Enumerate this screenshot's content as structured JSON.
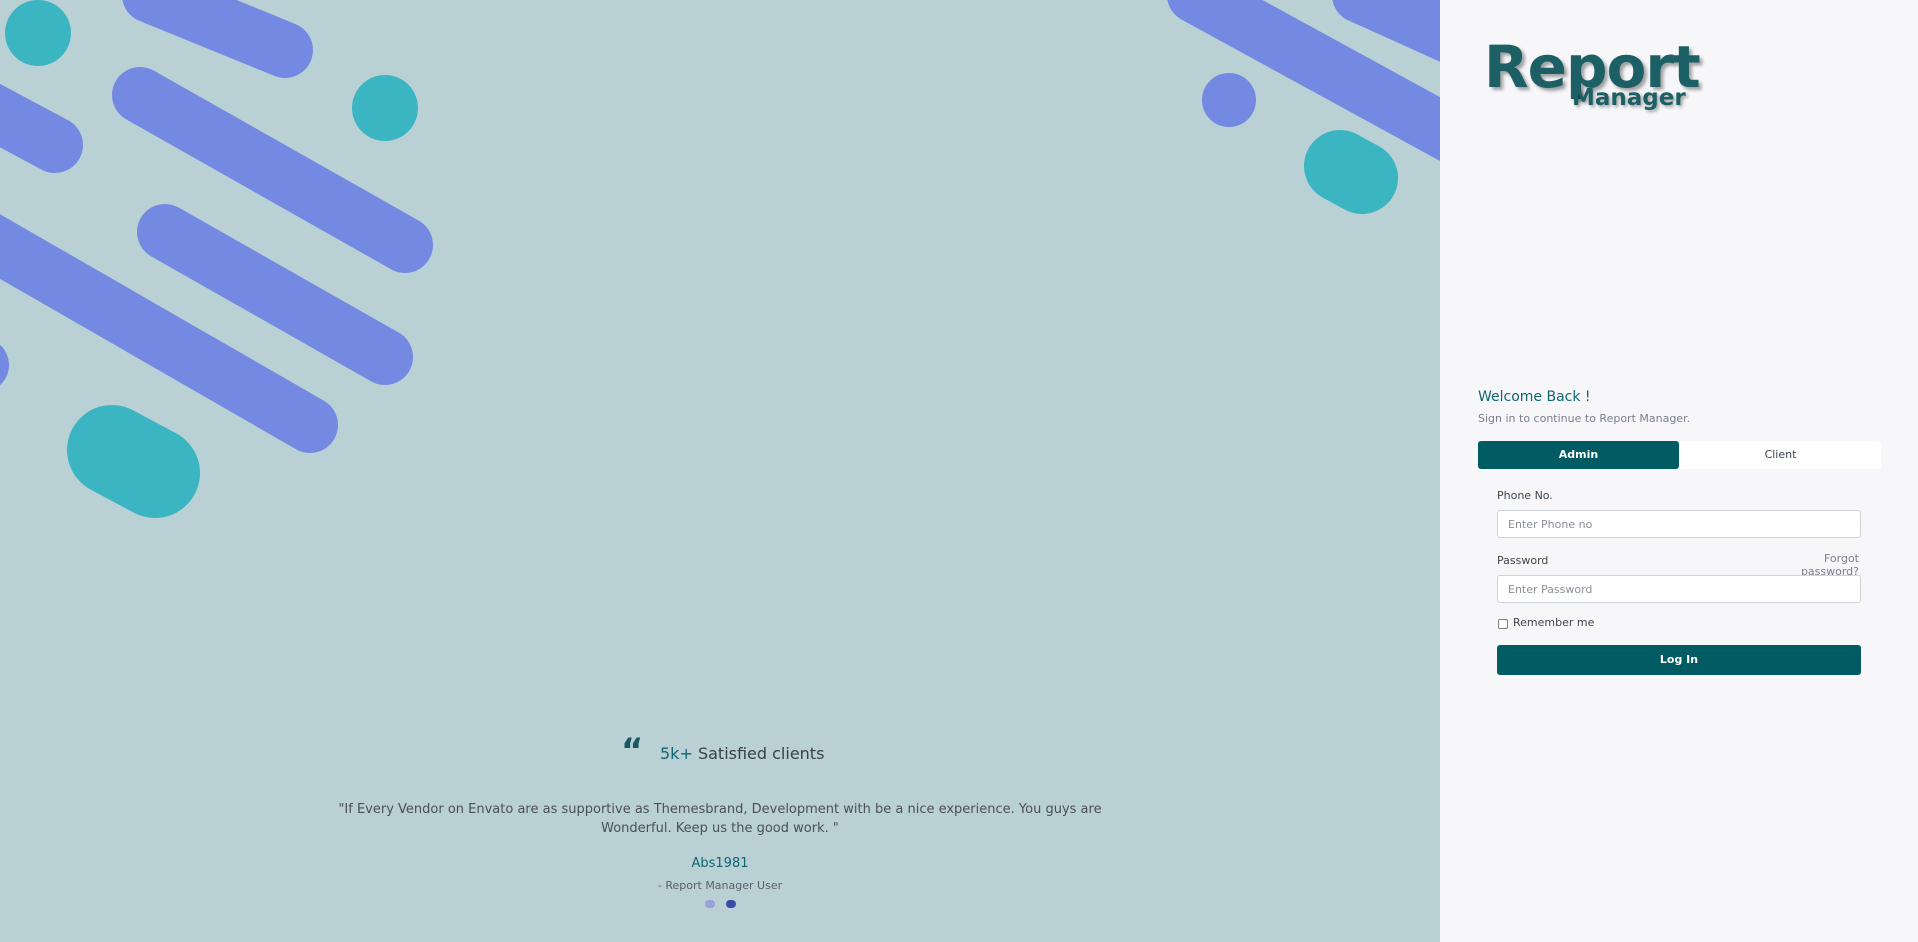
{
  "colors": {
    "left_background": "#b9d1d5",
    "shape_purple": "#7489e2",
    "shape_teal": "#3bb5c2",
    "primary": "#005b63",
    "accent_text": "#0f6670"
  },
  "brand": {
    "line1": "Report",
    "line2": "Manager"
  },
  "login": {
    "welcome": "Welcome Back !",
    "subtitle": "Sign in to continue to Report Manager.",
    "tabs": [
      {
        "label": "Admin",
        "active": true
      },
      {
        "label": "Client",
        "active": false
      }
    ],
    "phone_label": "Phone No.",
    "phone_placeholder": "Enter Phone no",
    "password_label": "Password",
    "password_placeholder": "Enter Password",
    "forgot": "Forgot password?",
    "remember": "Remember me",
    "remember_checked": false,
    "submit": "Log In"
  },
  "testimonial": {
    "quote_icon": "quote-open-icon",
    "stat_highlight": "5k+",
    "stat_text": "Satisfied clients",
    "quote": "\"If Every Vendor on Envato are as supportive as Themesbrand, Development with be a nice experience. You guys are Wonderful. Keep us the good work. \"",
    "author": "Abs1981",
    "role": "- Report Manager User",
    "slides": 2,
    "active_slide": 2
  }
}
